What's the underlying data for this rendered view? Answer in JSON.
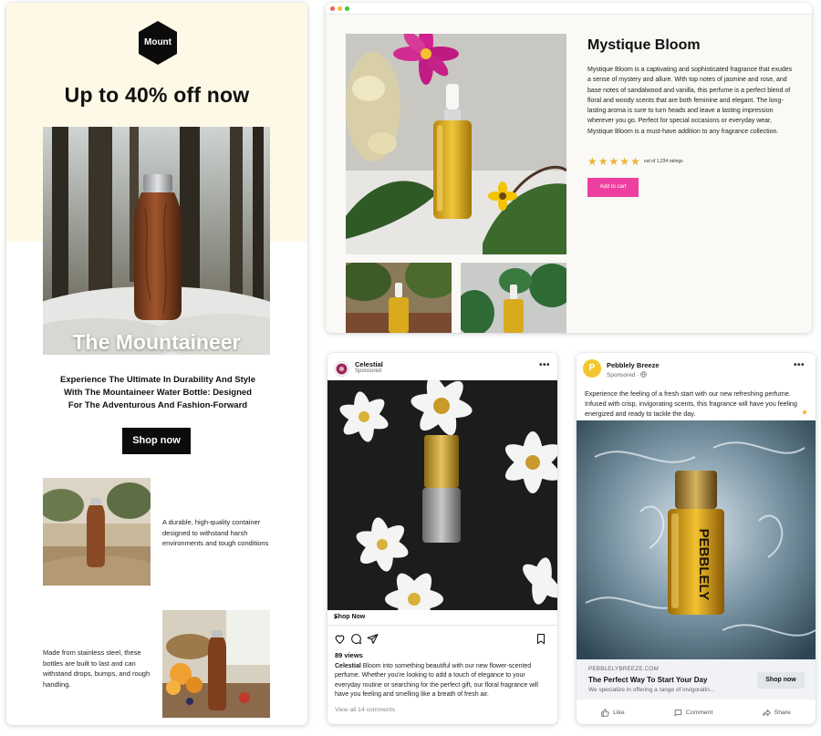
{
  "email": {
    "logo_text": "Mount",
    "headline": "Up to 40% off now",
    "hero_title": "The Mountaineer",
    "description": "Experience The Ultimate In Durability And Style With The Mountaineer Water Bottle: Designed For The Adventurous And Fashion-Forward",
    "shop_button": "Shop now",
    "feature_1": "A durable, high-quality container designed to withstand harsh environments and tough conditions",
    "feature_2": "Made from stainless steel, these bottles are built to last and can withstand drops, bumps, and rough handling."
  },
  "product": {
    "title": "Mystique Bloom",
    "description": "Mystique Bloom is a captivating and sophisticated fragrance that exudes a sense of mystery and allure. With top notes of jasmine and rose, and base notes of sandalwood and vanilla, this perfume is a perfect blend of floral and woody scents that are both feminine and elegant. The long-lasting aroma is sure to turn heads and leave a lasting impression wherever you go. Perfect for special occasions or everyday wear, Mystique Bloom is a must-have addition to any fragrance collection.",
    "star_rating": 5,
    "rating_text": "out of 1,234 ratings",
    "cart_button": "Add to cart",
    "colors": {
      "accent": "#ec3fa0",
      "star": "#e7b53a"
    }
  },
  "instagram": {
    "account": "Celestial",
    "sponsored": "Sponsored",
    "more": "•••",
    "shop_now": "Shop Now",
    "chevron": "›",
    "views": "89 views",
    "caption_account": "Celestial",
    "caption": "Bloom into something beautiful with our new flower-scented perfume. Whether you're looking to add a touch of elegance to your everyday routine or searching for the perfect gift, our floral fragrance will have you feeling and smelling like a breath of fresh air.",
    "comments": "View all 14 comments",
    "action_icons": [
      "heart-icon",
      "comment-icon",
      "share-icon",
      "bookmark-icon"
    ]
  },
  "facebook": {
    "avatar_letter": "P",
    "page_name": "Pebblely Breeze",
    "sponsored": "Sponsored ·",
    "more": "•••",
    "post_text": "Experience the feeling of a fresh start with our new refreshing perfume. Infused with crisp, invigorating scents, this fragrance will have you feeling energized and ready to tackle the day.",
    "bottle_label": "PEBBLELY",
    "link_domain": "PEBBLELYBREEZE.COM",
    "link_title": "The Perfect Way To Start Your Day",
    "link_subtitle": "We specialize in offering a range of invigoratin...",
    "link_button": "Shop now",
    "actions": [
      "Like",
      "Comment",
      "Share"
    ]
  }
}
